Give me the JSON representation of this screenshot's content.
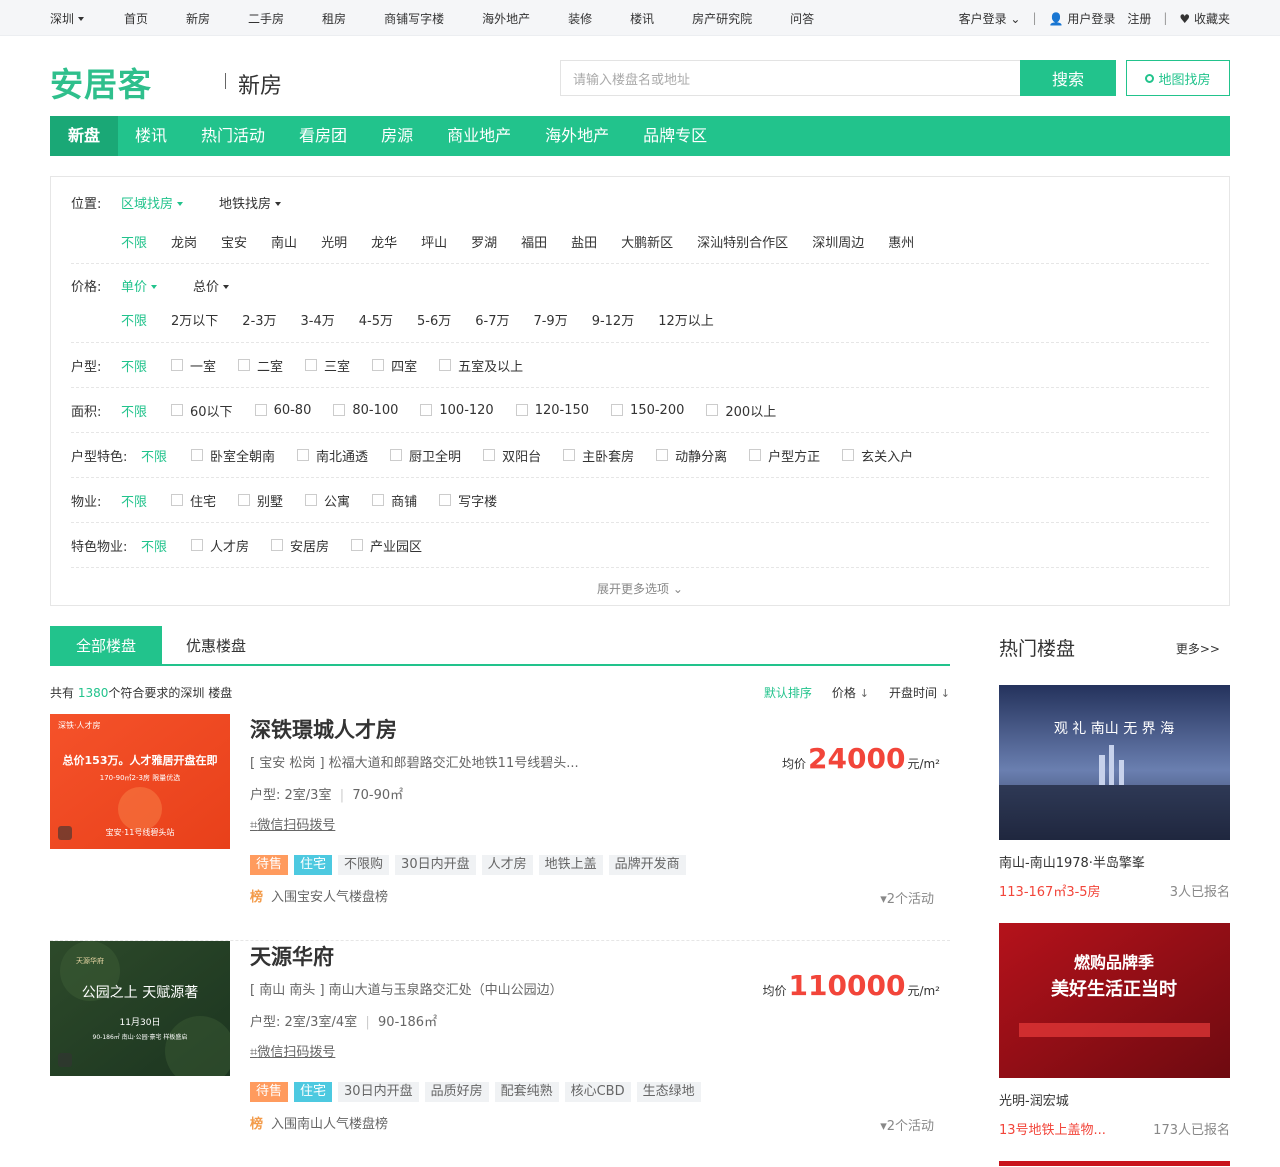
{
  "topbar": {
    "city": "深圳",
    "nav": [
      "首页",
      "新房",
      "二手房",
      "租房",
      "商铺写字楼",
      "海外地产",
      "装修",
      "楼讯",
      "房产研究院",
      "问答"
    ],
    "customer_login": "客户登录",
    "user_login": "用户登录",
    "register": "注册",
    "favorite": "收藏夹"
  },
  "header": {
    "logo": "安居客",
    "subtitle": "新房",
    "search_placeholder": "请输入楼盘名或地址",
    "search_button": "搜索",
    "map_button": "地图找房"
  },
  "greennav": [
    "新盘",
    "楼讯",
    "热门活动",
    "看房团",
    "房源",
    "商业地产",
    "海外地产",
    "品牌专区"
  ],
  "filter": {
    "position_label": "位置:",
    "position_modes": [
      "区域找房",
      "地铁找房"
    ],
    "areas": [
      "不限",
      "龙岗",
      "宝安",
      "南山",
      "光明",
      "龙华",
      "坪山",
      "罗湖",
      "福田",
      "盐田",
      "大鹏新区",
      "深汕特别合作区",
      "深圳周边",
      "惠州"
    ],
    "price_label": "价格:",
    "price_modes": [
      "单价",
      "总价"
    ],
    "prices": [
      "不限",
      "2万以下",
      "2-3万",
      "3-4万",
      "4-5万",
      "5-6万",
      "6-7万",
      "7-9万",
      "9-12万",
      "12万以上"
    ],
    "layout_label": "户型:",
    "unlimited": "不限",
    "layouts": [
      "一室",
      "二室",
      "三室",
      "四室",
      "五室及以上"
    ],
    "area_label": "面积:",
    "sizes": [
      "60以下",
      "60-80",
      "80-100",
      "100-120",
      "120-150",
      "150-200",
      "200以上"
    ],
    "feature_label": "户型特色:",
    "features": [
      "卧室全朝南",
      "南北通透",
      "厨卫全明",
      "双阳台",
      "主卧套房",
      "动静分离",
      "户型方正",
      "玄关入户"
    ],
    "property_label": "物业:",
    "properties": [
      "住宅",
      "别墅",
      "公寓",
      "商铺",
      "写字楼"
    ],
    "special_label": "特色物业:",
    "specials": [
      "人才房",
      "安居房",
      "产业园区"
    ],
    "more_options": "展开更多选项"
  },
  "main": {
    "tabs": [
      "全部楼盘",
      "优惠楼盘"
    ],
    "count_prefix": "共有",
    "count": "1380",
    "count_suffix": "个符合要求的深圳 楼盘",
    "sort": [
      "默认排序",
      "价格",
      "开盘时间"
    ]
  },
  "listings": [
    {
      "name": "深铁璟城人才房",
      "address": "[ 宝安 松岗 ] 松福大道和郎碧路交汇处地铁11号线碧头...",
      "layout_label": "户型:",
      "layout": "2室/3室",
      "area": "70-90㎡",
      "wechat": "微信扫码拨号",
      "tags": [
        "待售",
        "住宅",
        "不限购",
        "30日内开盘",
        "人才房",
        "地铁上盖",
        "品牌开发商"
      ],
      "rank_badge": "榜",
      "rank": "入围宝安人气楼盘榜",
      "activities": "2个活动",
      "price_label": "均价",
      "price": "24000",
      "price_unit": "元/m²",
      "img_badge": "深铁·人才房",
      "img_line1": "总价153万。人才雅居开盘在即",
      "img_line2": "170-90㎡2-3房 限量优选",
      "img_line3": "宝安·11号线碧头站"
    },
    {
      "name": "天源华府",
      "address": "[ 南山 南头 ] 南山大道与玉泉路交汇处（中山公园边）",
      "layout_label": "户型:",
      "layout": "2室/3室/4室",
      "area": "90-186㎡",
      "wechat": "微信扫码拨号",
      "tags": [
        "待售",
        "住宅",
        "30日内开盘",
        "品质好房",
        "配套纯熟",
        "核心CBD",
        "生态绿地"
      ],
      "rank_badge": "榜",
      "rank": "入围南山人气楼盘榜",
      "activities": "2个活动",
      "price_label": "均价",
      "price": "110000",
      "price_unit": "元/m²",
      "img_badge": "天源华府",
      "img_line1": "公园之上 天赋源著",
      "img_line2": "11月30日",
      "img_line3": "90-186㎡ 南山·公园·豪宅 样板盛启"
    }
  ],
  "sidebar": {
    "title": "热门楼盘",
    "more": "更多>>",
    "items": [
      {
        "name": "南山-南山1978·半岛擎峯",
        "price": "113-167㎡3-5房",
        "count": "3人已报名",
        "img_text": "观 礼 南山 无 界 海"
      },
      {
        "name": "光明-润宏城",
        "price": "13号地铁上盖物...",
        "count": "173人已报名",
        "img_text": "燃购品牌季",
        "img_text2": "美好生活正当时"
      }
    ]
  },
  "colors": {
    "brand": "#22c38c",
    "price": "#f2453a",
    "tag_orange": "#ff9b5e",
    "tag_teal": "#4dc9e0"
  }
}
